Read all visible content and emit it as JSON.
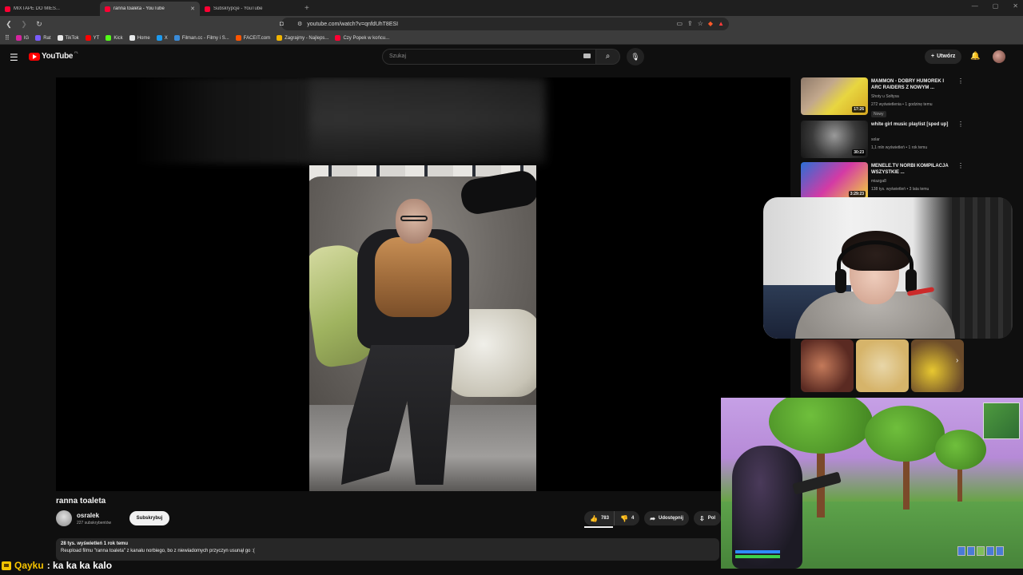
{
  "browser": {
    "tabs": [
      {
        "label": "MIXTAPE DO MIES...",
        "active": false
      },
      {
        "label": "ranna toaleta - YouTube",
        "active": true
      },
      {
        "label": "Subskrypcje - YouTube",
        "active": false
      }
    ],
    "url": "youtube.com/watch?v=qnfdUhT8ESI",
    "bookmarks": [
      "IG",
      "Rat",
      "TikTok",
      "YT",
      "Kick",
      "Home",
      "X",
      "Filman.cc - Filmy i S...",
      "FACEIT.com",
      "Zagrajmy - Najleps...",
      "Czy Popek w końcu..."
    ],
    "bookmark_colors": [
      "#d6249f",
      "#7a5cff",
      "#111111",
      "#ff0000",
      "#53fc18",
      "#e7e9ea",
      "#1d9bf0",
      "#3a8bd8",
      "#ff5500",
      "#f0b400",
      "#ff0033"
    ]
  },
  "youtube": {
    "logo": "YouTube",
    "country": "PL",
    "search_placeholder": "Szukaj",
    "create_label": "Utwórz"
  },
  "video": {
    "title": "ranna toaleta",
    "channel": "osralek",
    "subscribers": "227 subskrybentów",
    "subscribe_label": "Subskrybuj",
    "likes": "783",
    "dislikes": "4",
    "share_label": "Udostępnij",
    "download_label": "Pol",
    "views_date": "28 tys. wyświetleń  1 rok temu",
    "description": "Reupload filmu \"ranna toaleta\" z kanału norbiego, bo z niewiadomych przyczyn usunął go :("
  },
  "recommendations": [
    {
      "title": "MAMMON - DOBRY HUMOREK I ARC RAIDERS Z NOWYM ...",
      "channel": "Shoty u Sołtysa",
      "meta": "272 wyświetlenia • 1 godzinę temu",
      "badge": "Nowy",
      "duration": "17:26",
      "thumb": [
        "#e8d640",
        "#3a2d20"
      ]
    },
    {
      "title": "white girl music playlist [sped up]",
      "channel": "solar",
      "meta": "1,1 mln wyświetleń • 1 rok temu",
      "badge": "",
      "duration": "30:23",
      "thumb": [
        "#2b2b2b",
        "#8c8c8c"
      ]
    },
    {
      "title": "MENELE.TV NORBI KOMPILACJA WSZYSTKIE ...",
      "channel": "miazga8",
      "meta": "138 tys. wyświetleń • 3 lata temu",
      "badge": "",
      "duration": "3:29:23",
      "thumb": [
        "#d43aa5",
        "#2a6fd6"
      ]
    }
  ],
  "shorts_colors": [
    [
      "#5a2a22",
      "#c47a5a"
    ],
    [
      "#d6b46a",
      "#e8d6a8"
    ],
    [
      "#6a4a2a",
      "#e8c830"
    ]
  ],
  "chat": {
    "user": "Qayku",
    "message": " : ka ka ka kalo"
  },
  "colors": {
    "background": "#0f0f0f",
    "accent": "#ff0000",
    "chat_user": "#f7c400"
  }
}
